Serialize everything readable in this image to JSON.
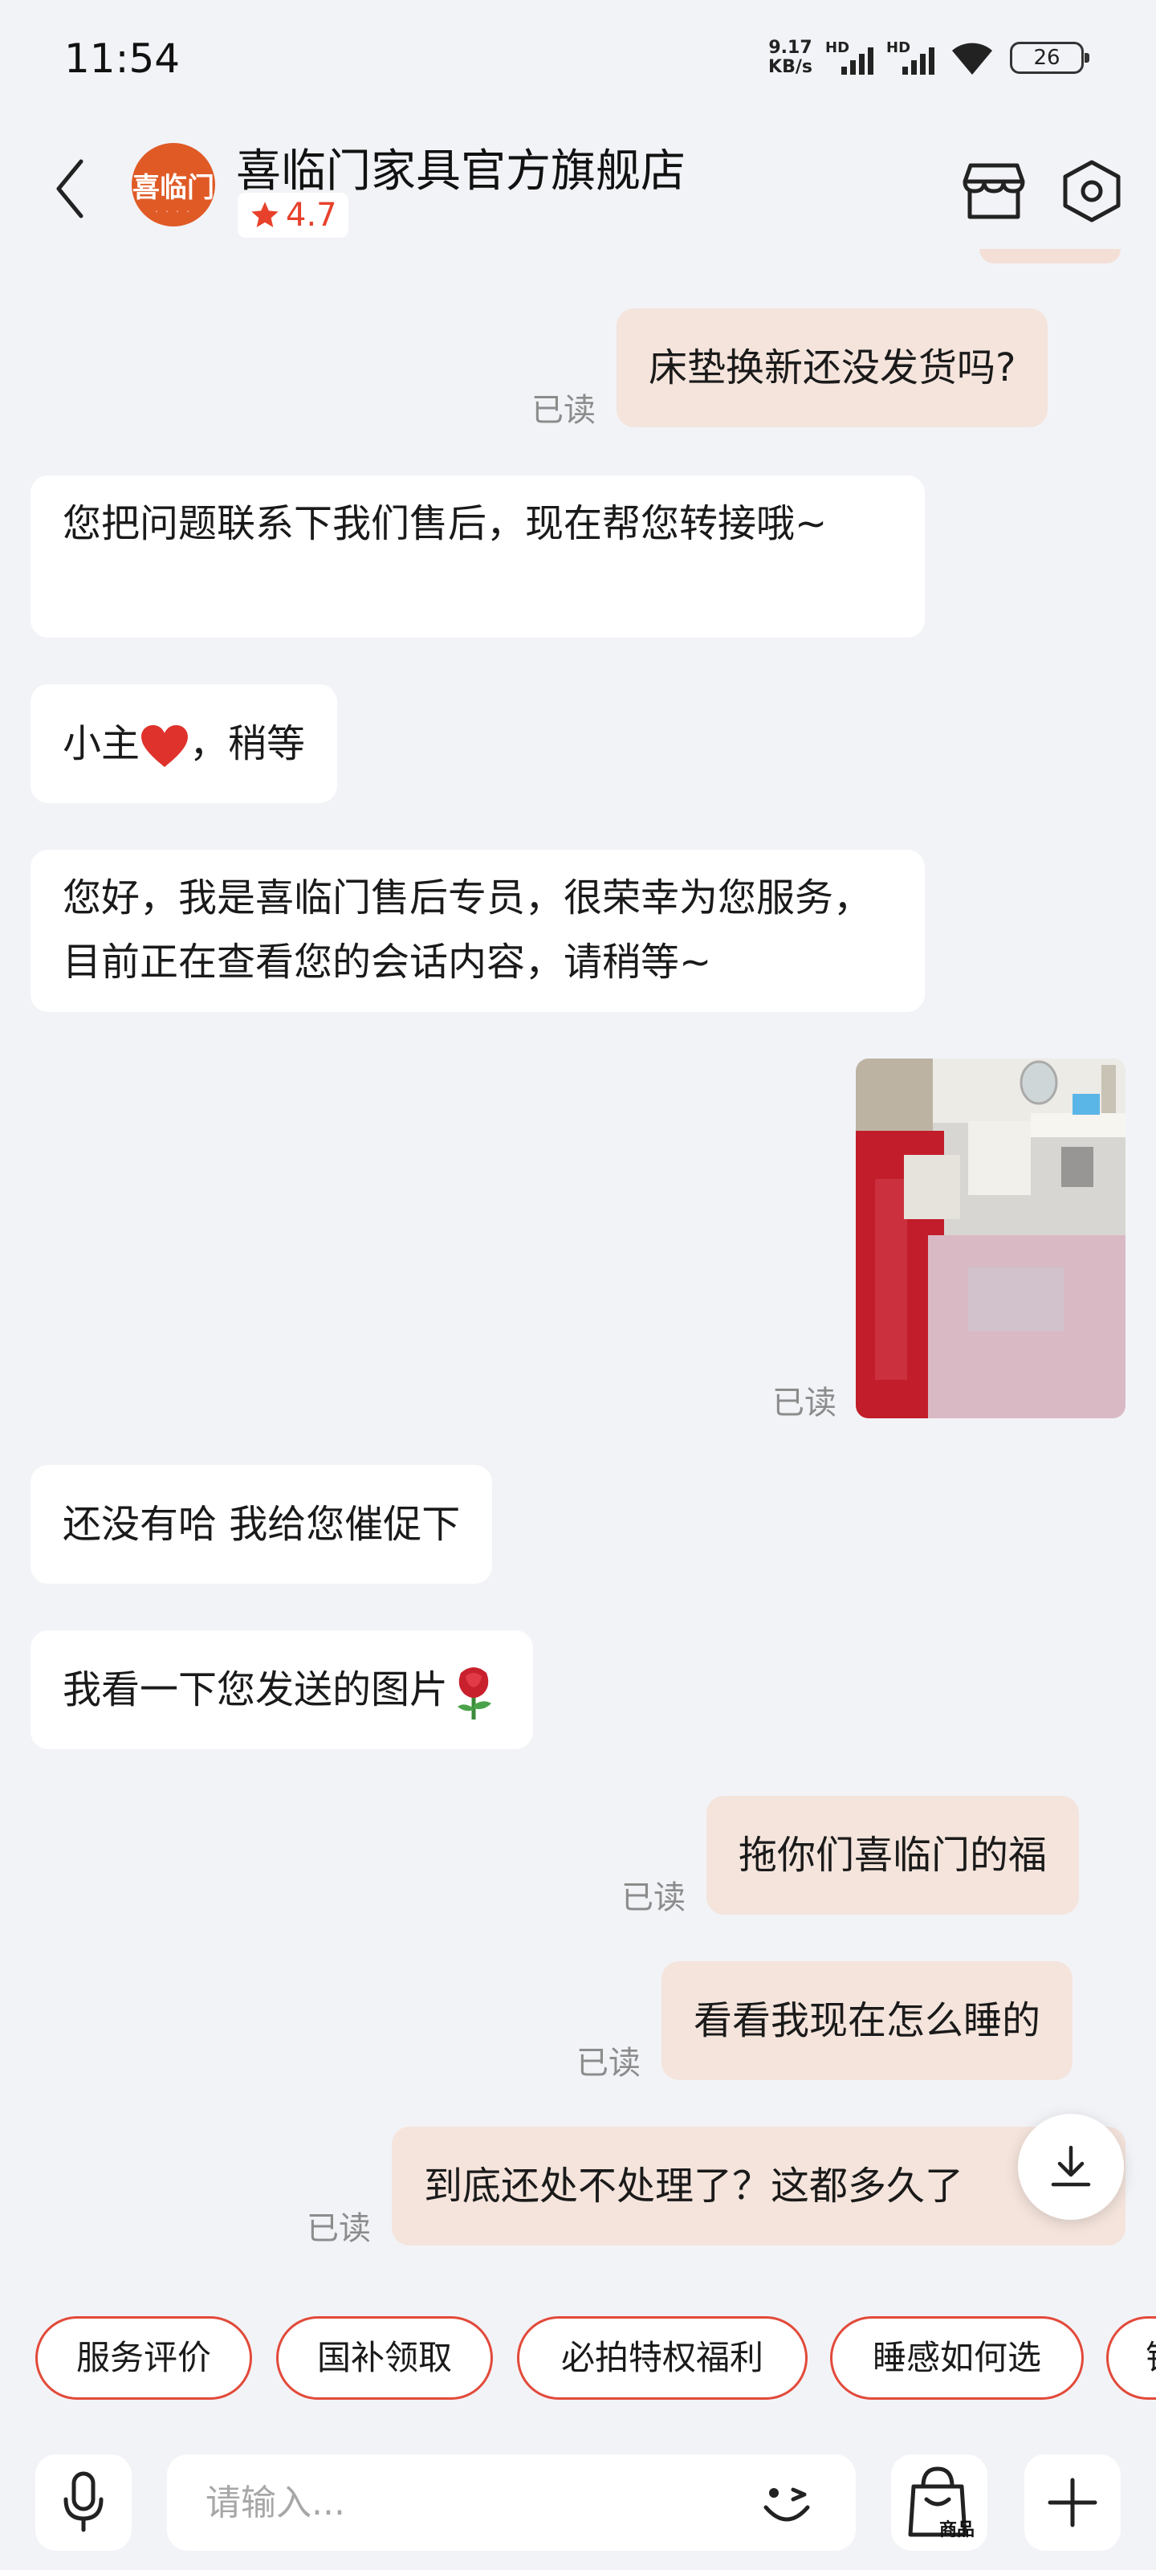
{
  "status_bar": {
    "time": "11:54",
    "net_speed_value": "9.17",
    "net_speed_unit": "KB/s",
    "sim1_label": "HD",
    "sim2_label": "HD",
    "battery": "26"
  },
  "header": {
    "store_logo_text": "喜临门",
    "store_name": "喜临门家具官方旗舰店",
    "rating": "4.7",
    "icons": [
      "back-icon",
      "shop-icon",
      "settings-icon"
    ]
  },
  "messages": [
    {
      "side": "out",
      "text": "床垫换新还没发货吗?",
      "read": "已读"
    },
    {
      "side": "in",
      "text": "您把问题联系下我们售后，现在帮您转接哦~"
    },
    {
      "side": "in",
      "text_before": "小主",
      "emoji": "heart",
      "text_after": "，稍等"
    },
    {
      "side": "in",
      "text": "您好，我是喜临门售后专员，很荣幸为您服务，目前正在查看您的会话内容，请稍等~"
    },
    {
      "side": "out",
      "type": "image",
      "read": "已读"
    },
    {
      "side": "in",
      "text": "还没有哈 我给您催促下"
    },
    {
      "side": "in",
      "text": "我看一下您发送的图片",
      "emoji": "rose"
    },
    {
      "side": "out",
      "text": "拖你们喜临门的福",
      "read": "已读"
    },
    {
      "side": "out",
      "text": "看看我现在怎么睡的",
      "read": "已读"
    },
    {
      "side": "out",
      "text": "到底还处不处理了？这都多久了",
      "read": "已读"
    }
  ],
  "quick_replies": [
    "服务评价",
    "国补领取",
    "必拍特权福利",
    "睡感如何选",
    "销"
  ],
  "input": {
    "placeholder": "请输入...",
    "goods_label": "商品"
  },
  "colors": {
    "accent": "#e24a3a",
    "outgoing_bubble": "#f4e4dc",
    "incoming_bubble": "#ffffff",
    "background": "#f2f3f7",
    "rating_star": "#e8412b"
  }
}
